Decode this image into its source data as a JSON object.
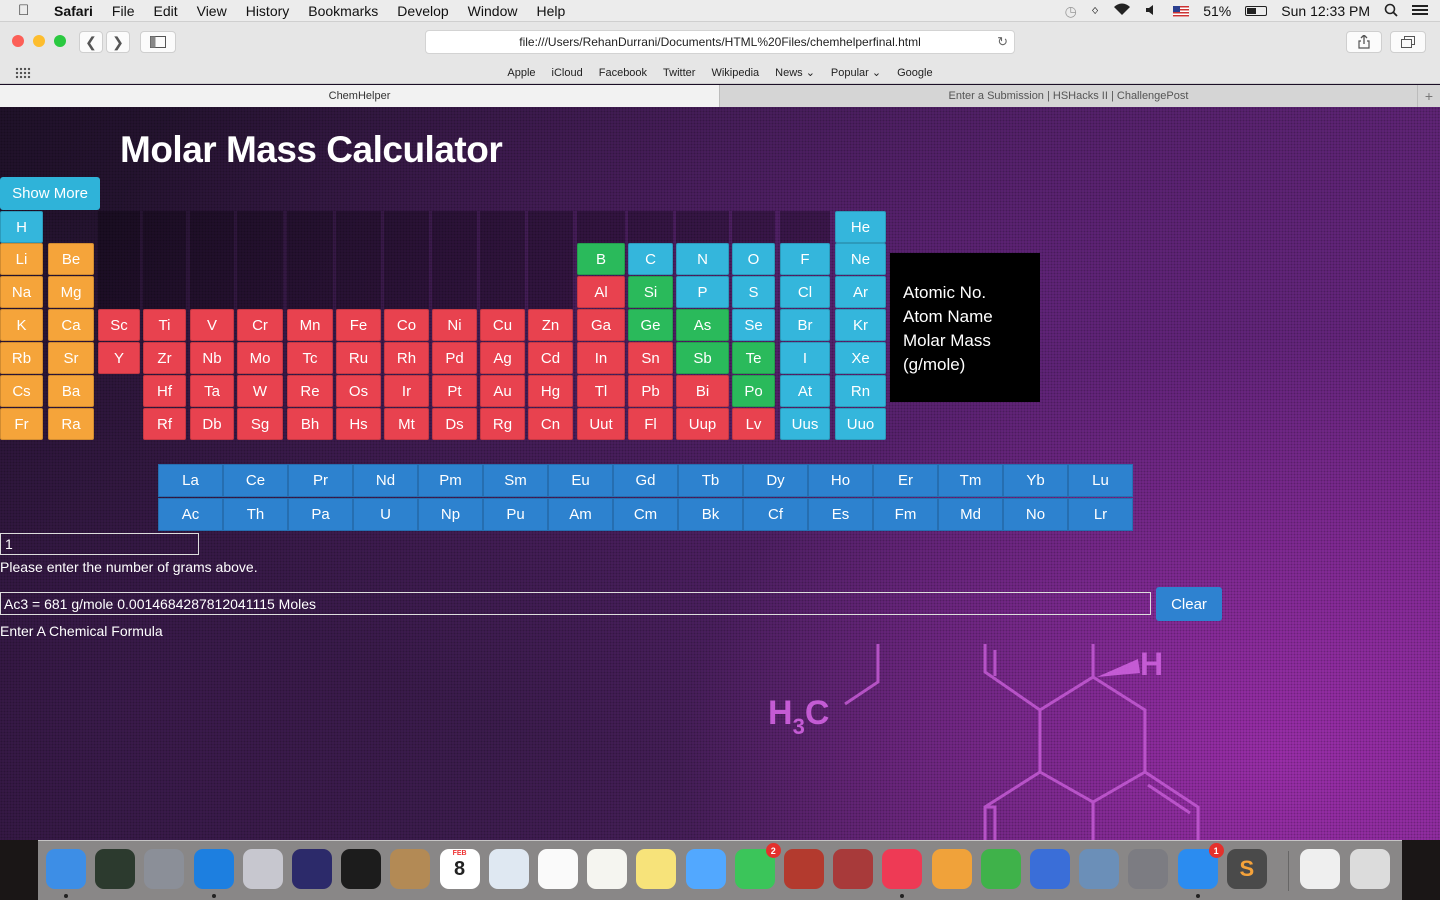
{
  "menubar": {
    "apple_icon": "apple-logo-icon",
    "app_name": "Safari",
    "items": [
      "File",
      "Edit",
      "View",
      "History",
      "Bookmarks",
      "Develop",
      "Window",
      "Help"
    ],
    "battery_percent": "51%",
    "battery_level": 0.51,
    "clock": "Sun 12:33 PM"
  },
  "browser": {
    "url": "file:///Users/RehanDurrani/Documents/HTML%20Files/chemhelperfinal.html",
    "favorites": [
      "Apple",
      "iCloud",
      "Facebook",
      "Twitter",
      "Wikipedia",
      "News ⌄",
      "Popular ⌄",
      "Google"
    ],
    "tabs": [
      "ChemHelper",
      "Enter a Submission | HSHacks II | ChallengePost"
    ],
    "new_tab": "+"
  },
  "page": {
    "title": "Molar Mass Calculator",
    "show_more": "Show More",
    "info": {
      "line1": "Atomic No.",
      "line2": "Atom Name",
      "line3": "Molar Mass",
      "line4": "(g/mole)"
    },
    "molecule": {
      "h3c": "H3C",
      "h_main": "H",
      "h_sub": "3",
      "c": "C",
      "h_right": "H"
    },
    "grams_value": "1",
    "grams_label": "Please enter the number of grams above.",
    "formula_value": "Ac3 = 681 g/mole 0.0014684287812041115 Moles",
    "clear_label": "Clear",
    "formula_label": "Enter A Chemical Formula"
  },
  "colors": {
    "cyan": "#34b6dc",
    "orange": "#f5a43a",
    "red": "#e8424f",
    "green": "#2aba5b",
    "blue": "#2d82cf"
  },
  "periodic_table": [
    {
      "symbol": "H",
      "col": 1,
      "row": 1,
      "color": "cyan"
    },
    {
      "symbol": "Li",
      "col": 1,
      "row": 2,
      "color": "orange"
    },
    {
      "symbol": "Na",
      "col": 1,
      "row": 3,
      "color": "orange"
    },
    {
      "symbol": "K",
      "col": 1,
      "row": 4,
      "color": "orange"
    },
    {
      "symbol": "Rb",
      "col": 1,
      "row": 5,
      "color": "orange"
    },
    {
      "symbol": "Cs",
      "col": 1,
      "row": 6,
      "color": "orange"
    },
    {
      "symbol": "Fr",
      "col": 1,
      "row": 7,
      "color": "orange"
    },
    {
      "symbol": "Be",
      "col": 2,
      "row": 2,
      "color": "orange"
    },
    {
      "symbol": "Mg",
      "col": 2,
      "row": 3,
      "color": "orange"
    },
    {
      "symbol": "Ca",
      "col": 2,
      "row": 4,
      "color": "orange"
    },
    {
      "symbol": "Sr",
      "col": 2,
      "row": 5,
      "color": "orange"
    },
    {
      "symbol": "Ba",
      "col": 2,
      "row": 6,
      "color": "orange"
    },
    {
      "symbol": "Ra",
      "col": 2,
      "row": 7,
      "color": "orange"
    },
    {
      "symbol": "Sc",
      "col": 3,
      "row": 4,
      "color": "red"
    },
    {
      "symbol": "Y",
      "col": 3,
      "row": 5,
      "color": "red"
    },
    {
      "symbol": "Ti",
      "col": 4,
      "row": 4,
      "color": "red"
    },
    {
      "symbol": "Zr",
      "col": 4,
      "row": 5,
      "color": "red"
    },
    {
      "symbol": "Hf",
      "col": 4,
      "row": 6,
      "color": "red"
    },
    {
      "symbol": "Rf",
      "col": 4,
      "row": 7,
      "color": "red"
    },
    {
      "symbol": "V",
      "col": 5,
      "row": 4,
      "color": "red"
    },
    {
      "symbol": "Nb",
      "col": 5,
      "row": 5,
      "color": "red"
    },
    {
      "symbol": "Ta",
      "col": 5,
      "row": 6,
      "color": "red"
    },
    {
      "symbol": "Db",
      "col": 5,
      "row": 7,
      "color": "red"
    },
    {
      "symbol": "Cr",
      "col": 6,
      "row": 4,
      "color": "red"
    },
    {
      "symbol": "Mo",
      "col": 6,
      "row": 5,
      "color": "red"
    },
    {
      "symbol": "W",
      "col": 6,
      "row": 6,
      "color": "red"
    },
    {
      "symbol": "Sg",
      "col": 6,
      "row": 7,
      "color": "red"
    },
    {
      "symbol": "Mn",
      "col": 7,
      "row": 4,
      "color": "red"
    },
    {
      "symbol": "Tc",
      "col": 7,
      "row": 5,
      "color": "red"
    },
    {
      "symbol": "Re",
      "col": 7,
      "row": 6,
      "color": "red"
    },
    {
      "symbol": "Bh",
      "col": 7,
      "row": 7,
      "color": "red"
    },
    {
      "symbol": "Fe",
      "col": 8,
      "row": 4,
      "color": "red"
    },
    {
      "symbol": "Ru",
      "col": 8,
      "row": 5,
      "color": "red"
    },
    {
      "symbol": "Os",
      "col": 8,
      "row": 6,
      "color": "red"
    },
    {
      "symbol": "Hs",
      "col": 8,
      "row": 7,
      "color": "red"
    },
    {
      "symbol": "Co",
      "col": 9,
      "row": 4,
      "color": "red"
    },
    {
      "symbol": "Rh",
      "col": 9,
      "row": 5,
      "color": "red"
    },
    {
      "symbol": "Ir",
      "col": 9,
      "row": 6,
      "color": "red"
    },
    {
      "symbol": "Mt",
      "col": 9,
      "row": 7,
      "color": "red"
    },
    {
      "symbol": "Ni",
      "col": 10,
      "row": 4,
      "color": "red"
    },
    {
      "symbol": "Pd",
      "col": 10,
      "row": 5,
      "color": "red"
    },
    {
      "symbol": "Pt",
      "col": 10,
      "row": 6,
      "color": "red"
    },
    {
      "symbol": "Ds",
      "col": 10,
      "row": 7,
      "color": "red"
    },
    {
      "symbol": "Cu",
      "col": 11,
      "row": 4,
      "color": "red"
    },
    {
      "symbol": "Ag",
      "col": 11,
      "row": 5,
      "color": "red"
    },
    {
      "symbol": "Au",
      "col": 11,
      "row": 6,
      "color": "red"
    },
    {
      "symbol": "Rg",
      "col": 11,
      "row": 7,
      "color": "red"
    },
    {
      "symbol": "Zn",
      "col": 12,
      "row": 4,
      "color": "red"
    },
    {
      "symbol": "Cd",
      "col": 12,
      "row": 5,
      "color": "red"
    },
    {
      "symbol": "Hg",
      "col": 12,
      "row": 6,
      "color": "red"
    },
    {
      "symbol": "Cn",
      "col": 12,
      "row": 7,
      "color": "red"
    },
    {
      "symbol": "B",
      "col": 13,
      "row": 2,
      "color": "green"
    },
    {
      "symbol": "Al",
      "col": 13,
      "row": 3,
      "color": "red"
    },
    {
      "symbol": "Ga",
      "col": 13,
      "row": 4,
      "color": "red"
    },
    {
      "symbol": "In",
      "col": 13,
      "row": 5,
      "color": "red"
    },
    {
      "symbol": "Tl",
      "col": 13,
      "row": 6,
      "color": "red"
    },
    {
      "symbol": "Uut",
      "col": 13,
      "row": 7,
      "color": "red"
    },
    {
      "symbol": "C",
      "col": 14,
      "row": 2,
      "color": "cyan"
    },
    {
      "symbol": "Si",
      "col": 14,
      "row": 3,
      "color": "green"
    },
    {
      "symbol": "Ge",
      "col": 14,
      "row": 4,
      "color": "green"
    },
    {
      "symbol": "Sn",
      "col": 14,
      "row": 5,
      "color": "red"
    },
    {
      "symbol": "Pb",
      "col": 14,
      "row": 6,
      "color": "red"
    },
    {
      "symbol": "Fl",
      "col": 14,
      "row": 7,
      "color": "red"
    },
    {
      "symbol": "N",
      "col": 15,
      "row": 2,
      "color": "cyan"
    },
    {
      "symbol": "P",
      "col": 15,
      "row": 3,
      "color": "cyan"
    },
    {
      "symbol": "As",
      "col": 15,
      "row": 4,
      "color": "green"
    },
    {
      "symbol": "Sb",
      "col": 15,
      "row": 5,
      "color": "green"
    },
    {
      "symbol": "Bi",
      "col": 15,
      "row": 6,
      "color": "red"
    },
    {
      "symbol": "Uup",
      "col": 15,
      "row": 7,
      "color": "red"
    },
    {
      "symbol": "O",
      "col": 16,
      "row": 2,
      "color": "cyan"
    },
    {
      "symbol": "S",
      "col": 16,
      "row": 3,
      "color": "cyan"
    },
    {
      "symbol": "Se",
      "col": 16,
      "row": 4,
      "color": "cyan"
    },
    {
      "symbol": "Te",
      "col": 16,
      "row": 5,
      "color": "green"
    },
    {
      "symbol": "Po",
      "col": 16,
      "row": 6,
      "color": "green"
    },
    {
      "symbol": "Lv",
      "col": 16,
      "row": 7,
      "color": "red"
    },
    {
      "symbol": "F",
      "col": 17,
      "row": 2,
      "color": "cyan"
    },
    {
      "symbol": "Cl",
      "col": 17,
      "row": 3,
      "color": "cyan"
    },
    {
      "symbol": "Br",
      "col": 17,
      "row": 4,
      "color": "cyan"
    },
    {
      "symbol": "I",
      "col": 17,
      "row": 5,
      "color": "cyan"
    },
    {
      "symbol": "At",
      "col": 17,
      "row": 6,
      "color": "cyan"
    },
    {
      "symbol": "Uus",
      "col": 17,
      "row": 7,
      "color": "cyan"
    },
    {
      "symbol": "He",
      "col": 18,
      "row": 1,
      "color": "cyan"
    },
    {
      "symbol": "Ne",
      "col": 18,
      "row": 2,
      "color": "cyan"
    },
    {
      "symbol": "Ar",
      "col": 18,
      "row": 3,
      "color": "cyan"
    },
    {
      "symbol": "Kr",
      "col": 18,
      "row": 4,
      "color": "cyan"
    },
    {
      "symbol": "Xe",
      "col": 18,
      "row": 5,
      "color": "cyan"
    },
    {
      "symbol": "Rn",
      "col": 18,
      "row": 6,
      "color": "cyan"
    },
    {
      "symbol": "Uuo",
      "col": 18,
      "row": 7,
      "color": "cyan"
    }
  ],
  "lanthanides": [
    "La",
    "Ce",
    "Pr",
    "Nd",
    "Pm",
    "Sm",
    "Eu",
    "Gd",
    "Tb",
    "Dy",
    "Ho",
    "Er",
    "Tm",
    "Yb",
    "Lu"
  ],
  "actinides": [
    "Ac",
    "Th",
    "Pa",
    "U",
    "Np",
    "Pu",
    "Am",
    "Cm",
    "Bk",
    "Cf",
    "Es",
    "Fm",
    "Md",
    "No",
    "Lr"
  ],
  "dock": [
    {
      "icon": "finder-icon",
      "color": "#3d8ee6"
    },
    {
      "icon": "activity-monitor-icon",
      "color": "#2c3a2e"
    },
    {
      "icon": "launchpad-icon",
      "color": "#8b8f98"
    },
    {
      "icon": "safari-icon",
      "color": "#1d7fe0"
    },
    {
      "icon": "preview-icon",
      "color": "#c7c7cf"
    },
    {
      "icon": "eclipse-icon",
      "color": "#2c2a6a"
    },
    {
      "icon": "terminal-icon",
      "color": "#1c1c1c"
    },
    {
      "icon": "contacts-icon",
      "color": "#b38a55"
    },
    {
      "icon": "calendar-icon",
      "color": "#ffffff",
      "text": "8",
      "top": "FEB"
    },
    {
      "icon": "mail-icon",
      "color": "#dfe8f2"
    },
    {
      "icon": "reminders-icon",
      "color": "#fafafa"
    },
    {
      "icon": "textedit-icon",
      "color": "#f5f5f0"
    },
    {
      "icon": "notes-icon",
      "color": "#f7e37a"
    },
    {
      "icon": "messages-icon",
      "color": "#52a8ff"
    },
    {
      "icon": "facetime-icon",
      "color": "#3bc55a",
      "badge": "2"
    },
    {
      "icon": "photo-booth-icon",
      "color": "#b33a2e"
    },
    {
      "icon": "photos-icon",
      "color": "#a83a3a"
    },
    {
      "icon": "itunes-icon",
      "color": "#ee3a55"
    },
    {
      "icon": "pages-icon",
      "color": "#f0a23a"
    },
    {
      "icon": "numbers-icon",
      "color": "#3fb24a"
    },
    {
      "icon": "keynote-icon",
      "color": "#3a6ed8"
    },
    {
      "icon": "iphoto-icon",
      "color": "#6b8fb8"
    },
    {
      "icon": "system-preferences-icon",
      "color": "#7c7c82"
    },
    {
      "icon": "app-store-icon",
      "color": "#2b8cf0",
      "badge": "1"
    },
    {
      "icon": "sublime-text-icon",
      "color": "#4a4a4a",
      "text": "S"
    },
    {
      "icon": "document-stack-icon",
      "color": "#efefef"
    },
    {
      "icon": "trash-icon",
      "color": "#dcdcdc"
    }
  ]
}
